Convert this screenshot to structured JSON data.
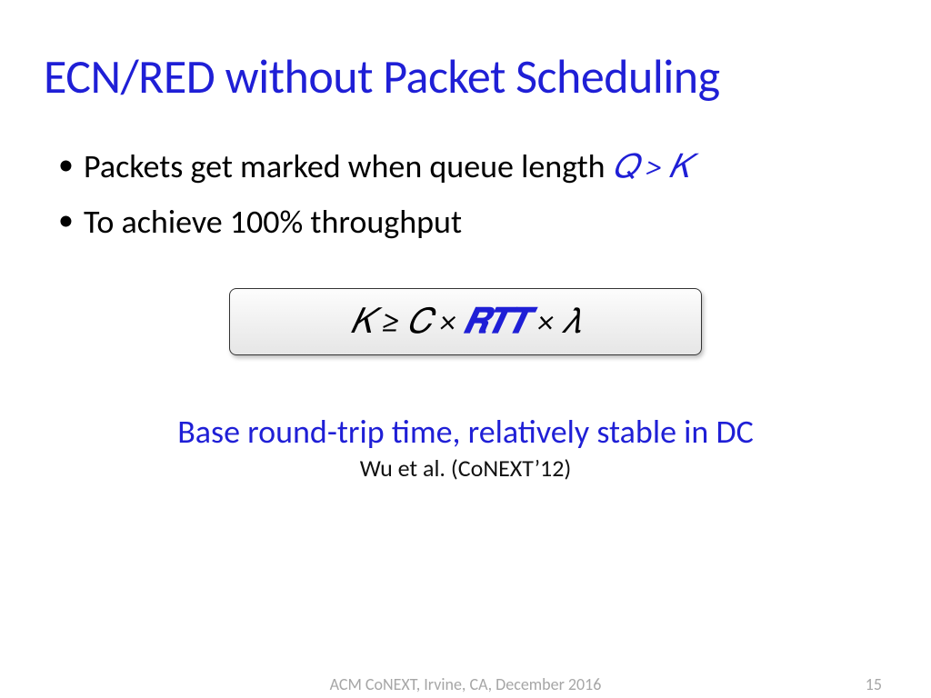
{
  "title": "ECN/RED without Packet Scheduling",
  "bullets": {
    "b1_text": "Packets get marked when queue length ",
    "b1_math": "𝑄 > 𝐾",
    "b2_text": "To achieve 100% throughput"
  },
  "formula": {
    "pre": "𝐾 ≥ 𝐶 × ",
    "rtt": "𝑹𝑻𝑻",
    "post": " × 𝜆"
  },
  "caption": {
    "main": "Base round-trip time, relatively stable in DC",
    "sub": "Wu et al. (CoNEXT’12)"
  },
  "footer": {
    "center": "ACM CoNEXT, Irvine, CA, December 2016",
    "page": "15"
  }
}
